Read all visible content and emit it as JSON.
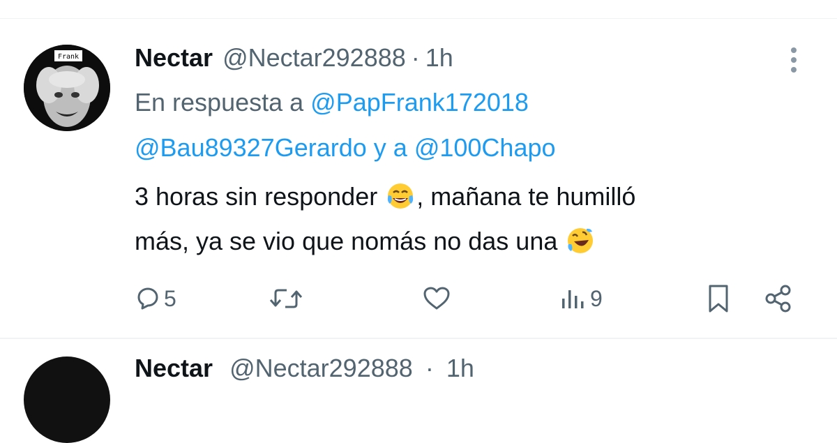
{
  "tweet": {
    "author_name": "Nectar",
    "author_handle": "@Nectar292888",
    "separator": "·",
    "time": "1h",
    "avatar_label": "Frank",
    "reply_prefix": "En respuesta a ",
    "reply_user_1": "@PapFrank172018",
    "reply_user_2": "@Bau89327Gerardo",
    "reply_joiner": " y a ",
    "reply_user_3": "@100Chapo",
    "body_line1_a": "3 horas sin responder ",
    "body_line1_b": ", mañana te humilló",
    "body_line2": "más, ya se vio que nomás no das una ",
    "emoji_1": "face-with-tears-of-joy",
    "emoji_2": "rolling-on-the-floor-laughing",
    "replies": "5",
    "views": "9"
  },
  "next_tweet": {
    "author_name": "Nectar",
    "author_handle": "@Nectar292888",
    "separator": "·",
    "time": "1h"
  },
  "colors": {
    "text": "#0f1419",
    "secondary": "#536471",
    "link": "#1d9bf0",
    "divider": "#eff3f4"
  }
}
